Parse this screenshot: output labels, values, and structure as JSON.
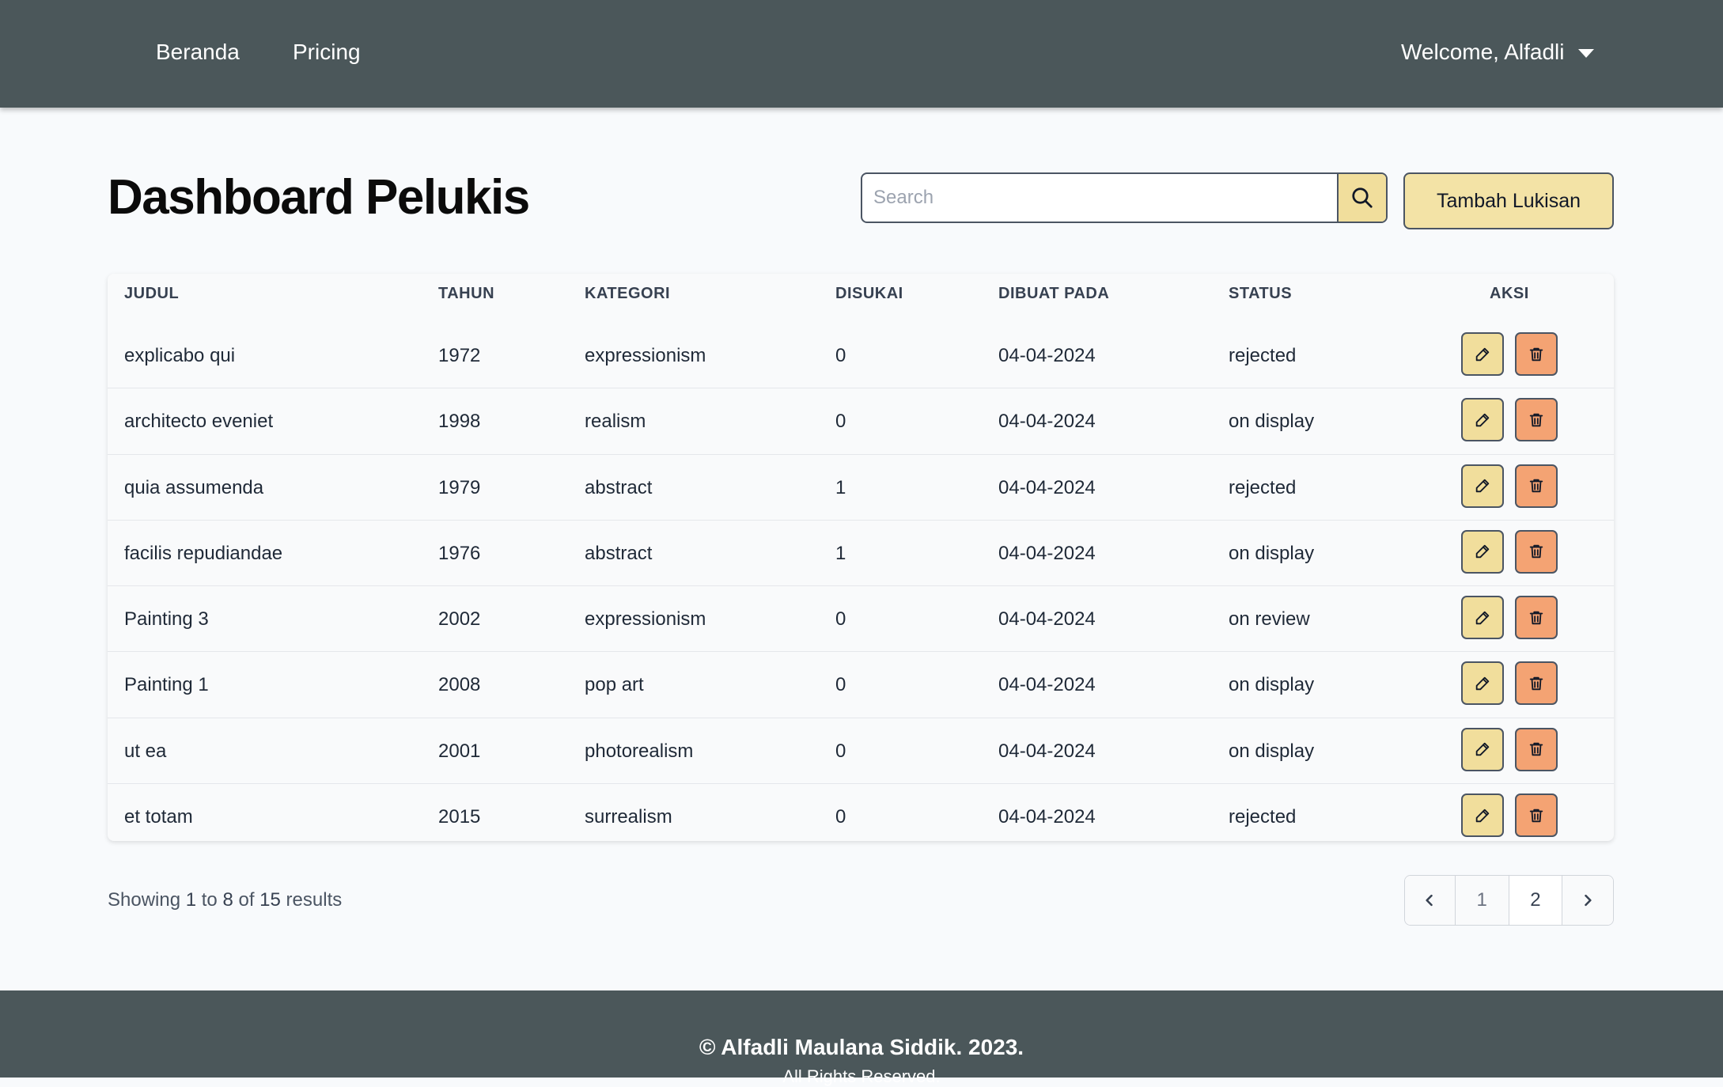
{
  "nav": {
    "home_label": "Beranda",
    "pricing_label": "Pricing",
    "user_label": "Welcome, Alfadli"
  },
  "page": {
    "title": "Dashboard Pelukis",
    "search_placeholder": "Search",
    "add_button_label": "Tambah Lukisan"
  },
  "table": {
    "headers": {
      "judul": "JUDUL",
      "tahun": "TAHUN",
      "kategori": "KATEGORI",
      "disukai": "DISUKAI",
      "dibuat_pada": "DIBUAT PADA",
      "status": "STATUS",
      "aksi": "AKSI"
    },
    "rows": [
      {
        "judul": "explicabo qui",
        "tahun": "1972",
        "kategori": "expressionism",
        "disukai": "0",
        "dibuat_pada": "04-04-2024",
        "status": "rejected"
      },
      {
        "judul": "architecto eveniet",
        "tahun": "1998",
        "kategori": "realism",
        "disukai": "0",
        "dibuat_pada": "04-04-2024",
        "status": "on display"
      },
      {
        "judul": "quia assumenda",
        "tahun": "1979",
        "kategori": "abstract",
        "disukai": "1",
        "dibuat_pada": "04-04-2024",
        "status": "rejected"
      },
      {
        "judul": "facilis repudiandae",
        "tahun": "1976",
        "kategori": "abstract",
        "disukai": "1",
        "dibuat_pada": "04-04-2024",
        "status": "on display"
      },
      {
        "judul": "Painting 3",
        "tahun": "2002",
        "kategori": "expressionism",
        "disukai": "0",
        "dibuat_pada": "04-04-2024",
        "status": "on review"
      },
      {
        "judul": "Painting 1",
        "tahun": "2008",
        "kategori": "pop art",
        "disukai": "0",
        "dibuat_pada": "04-04-2024",
        "status": "on display"
      },
      {
        "judul": "ut ea",
        "tahun": "2001",
        "kategori": "photorealism",
        "disukai": "0",
        "dibuat_pada": "04-04-2024",
        "status": "on display"
      },
      {
        "judul": "et totam",
        "tahun": "2015",
        "kategori": "surrealism",
        "disukai": "0",
        "dibuat_pada": "04-04-2024",
        "status": "rejected"
      }
    ]
  },
  "pagination": {
    "showing_prefix": "Showing",
    "from": "1",
    "to_word": "to",
    "to": "8",
    "of_word": "of",
    "total": "15",
    "results_word": "results",
    "pages": [
      "1",
      "2"
    ]
  },
  "footer": {
    "copyright": "© Alfadli Maulana Siddik. 2023.",
    "subtext": "All Rights Reserved."
  },
  "colors": {
    "header_bg": "#4b575a",
    "accent_yellow": "#f1de9c",
    "accent_orange": "#f4a373"
  }
}
